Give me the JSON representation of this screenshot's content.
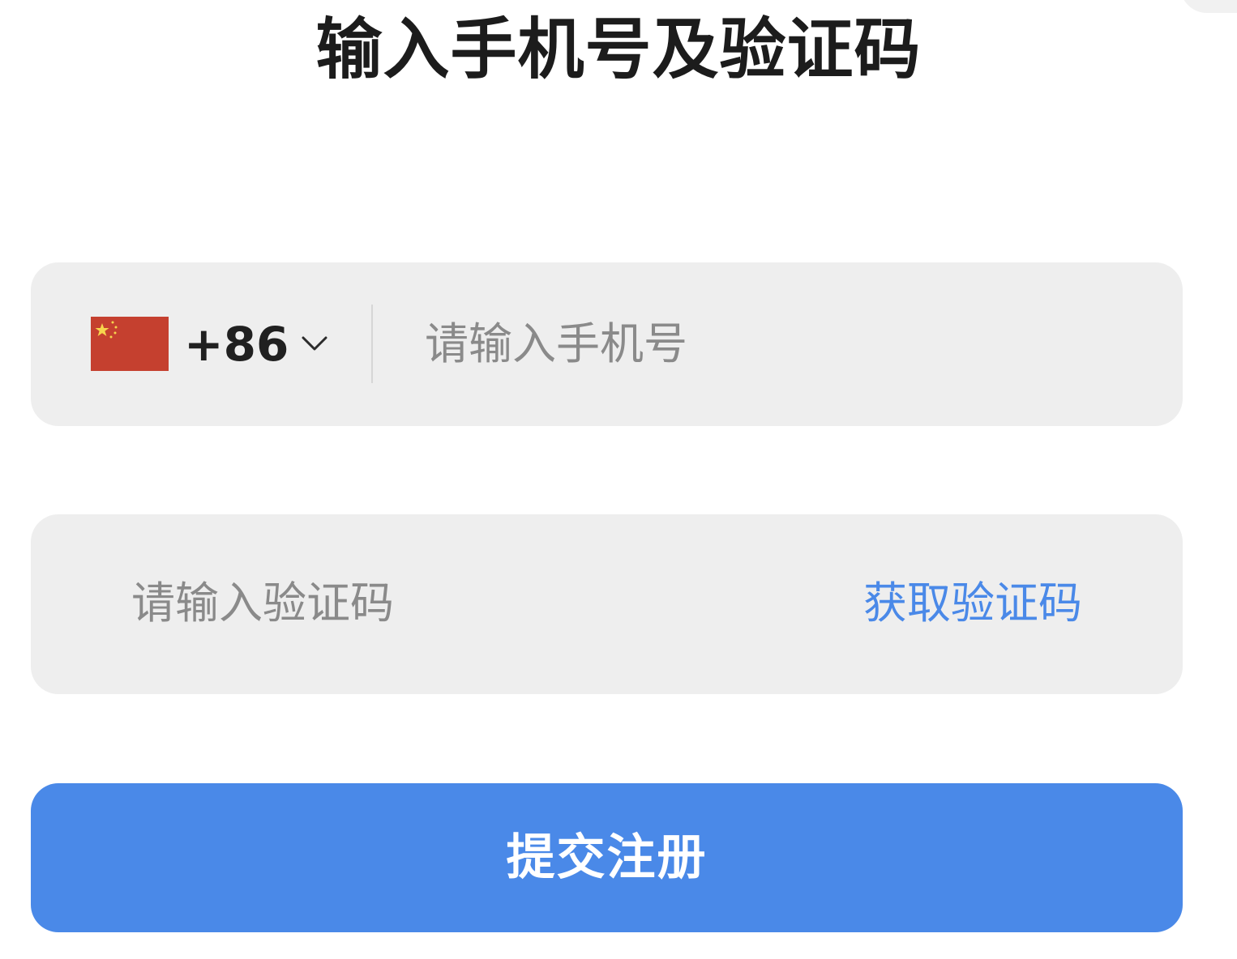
{
  "title": "输入手机号及验证码",
  "phone_field": {
    "flag_icon": "china-flag-icon",
    "country_code": "+86",
    "dropdown_icon": "chevron-down-icon",
    "placeholder": "请输入手机号",
    "value": ""
  },
  "code_field": {
    "placeholder": "请输入验证码",
    "value": "",
    "get_code_label": "获取验证码"
  },
  "submit_label": "提交注册",
  "colors": {
    "accent": "#4a89e8",
    "field_background": "#eeeeee",
    "flag_red": "#c5402f",
    "flag_yellow": "#f7d54d"
  }
}
